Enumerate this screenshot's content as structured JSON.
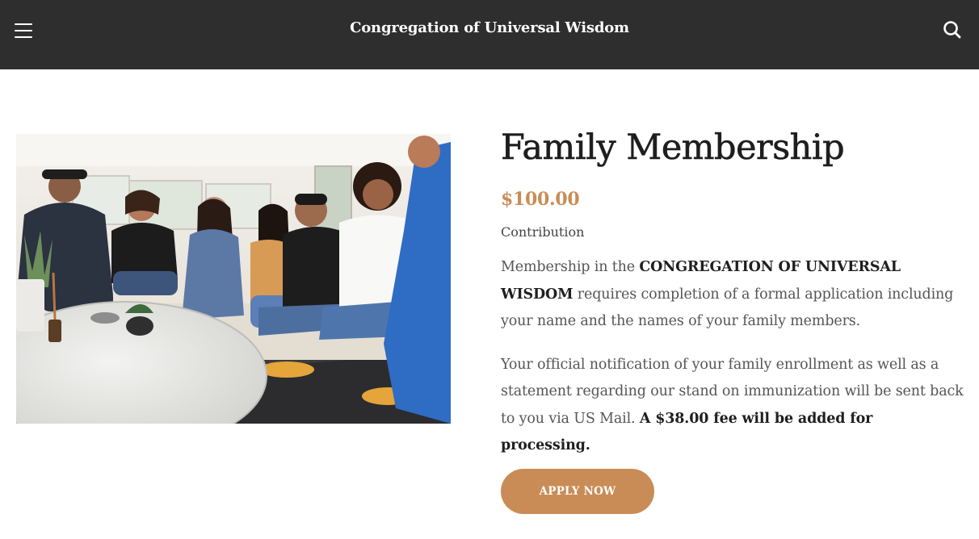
{
  "header": {
    "site_title": "Congregation of Universal Wisdom",
    "background": "#2e2e2e",
    "icons": {
      "menu": "hamburger-menu-icon",
      "search": "search-icon"
    }
  },
  "product": {
    "image_description_icon": "family-photo",
    "title": "Family Membership",
    "price": "$100.00",
    "subtitle": "Contribution",
    "description_1": {
      "pre": "Membership in the ",
      "bold": "CONGREGATION OF UNIVERSAL WISDOM",
      "post": " requires completion of a formal application including your name and the names of your family members."
    },
    "description_2": {
      "pre": "Your official notification of your family enrollment as well as a statement regarding our stand on immunization will be sent back to you via US Mail. ",
      "bold": "A $38.00 fee will be added for processing."
    },
    "cta_label": "APPLY NOW",
    "accent_color": "#c98c56"
  }
}
